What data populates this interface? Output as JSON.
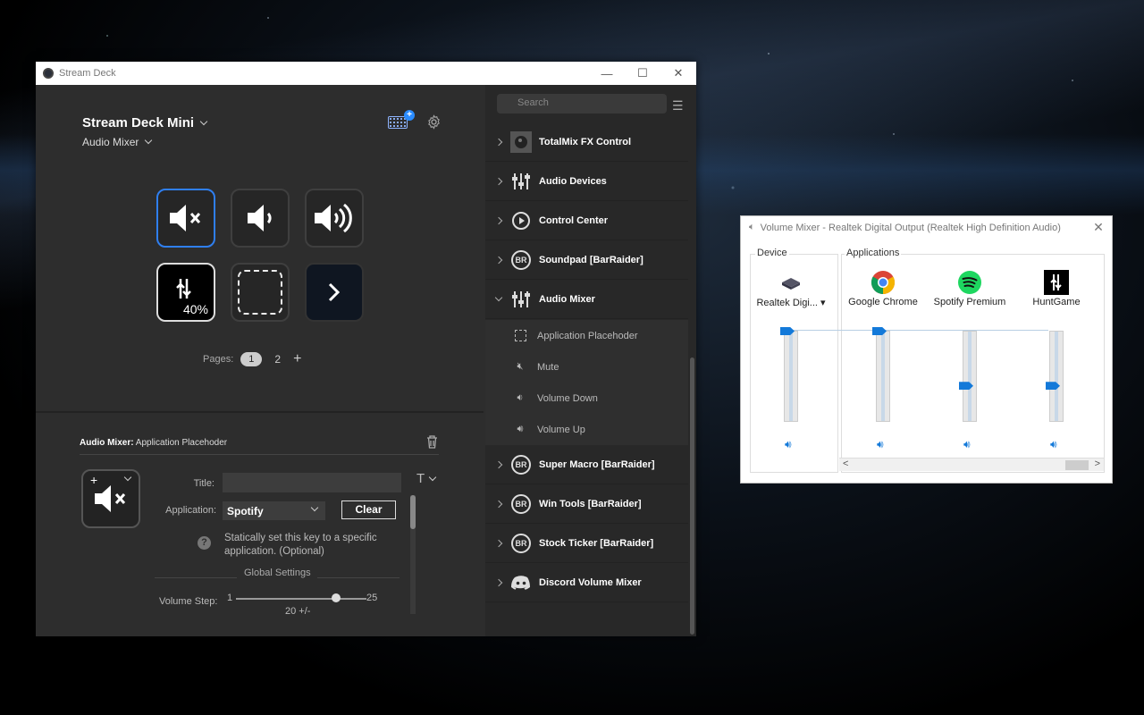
{
  "stream_deck": {
    "window_title": "Stream Deck",
    "device_name": "Stream Deck Mini",
    "profile_name": "Audio Mixer",
    "keys": [
      {
        "name": "mute-key",
        "label": ""
      },
      {
        "name": "volume-down-key",
        "label": ""
      },
      {
        "name": "volume-up-key",
        "label": ""
      },
      {
        "name": "huntgame-key",
        "label": "40%"
      },
      {
        "name": "placeholder-key",
        "label": ""
      },
      {
        "name": "next-page-key",
        "label": ""
      }
    ],
    "pages": {
      "label": "Pages:",
      "items": [
        "1",
        "2"
      ],
      "current": "1",
      "add": "+"
    },
    "properties": {
      "header_bold": "Audio Mixer:",
      "header_rest": " Application Placehoder",
      "title_label": "Title:",
      "title_value": "",
      "application_label": "Application:",
      "application_value": "Spotify",
      "clear_label": "Clear",
      "help_text": "Statically set this key to a specific application. (Optional)",
      "global_settings_label": "Global Settings",
      "volume_step_label": "Volume Step:",
      "slider_min": "1",
      "slider_max": "25",
      "slider_value": "20 +/-"
    },
    "search_placeholder": "Search",
    "categories_top": [
      {
        "label": "TotalMix FX Control",
        "icon": "totalmix-icon"
      },
      {
        "label": "Audio Devices",
        "icon": "sliders-icon"
      },
      {
        "label": "Control Center",
        "icon": "control-center-icon"
      },
      {
        "label": "Soundpad [BarRaider]",
        "icon": "barraider-icon"
      },
      {
        "label": "Audio Mixer",
        "icon": "sliders-icon",
        "expanded": true
      }
    ],
    "audio_mixer_actions": [
      {
        "label": "Application Placehoder",
        "icon": "placeholder-icon"
      },
      {
        "label": "Mute",
        "icon": "mute-icon"
      },
      {
        "label": "Volume Down",
        "icon": "volume-down-icon"
      },
      {
        "label": "Volume Up",
        "icon": "volume-up-icon"
      }
    ],
    "categories_bottom": [
      {
        "label": "Super Macro [BarRaider]",
        "icon": "barraider-icon"
      },
      {
        "label": "Win Tools [BarRaider]",
        "icon": "barraider-icon"
      },
      {
        "label": "Stock Ticker [BarRaider]",
        "icon": "barraider-icon"
      },
      {
        "label": "Discord Volume Mixer",
        "icon": "discord-icon"
      }
    ],
    "br_badge": "BR"
  },
  "volume_mixer": {
    "window_title": "Volume Mixer - Realtek Digital Output (Realtek High Definition Audio)",
    "device_group_label": "Device",
    "applications_group_label": "Applications",
    "channels": [
      {
        "name": "Realtek Digi...",
        "level": 1.0,
        "icon": "speaker-device-icon"
      },
      {
        "name": "Google Chrome",
        "level": 1.0,
        "icon": "chrome-icon"
      },
      {
        "name": "Spotify Premium",
        "level": 0.4,
        "icon": "spotify-icon"
      },
      {
        "name": "HuntGame",
        "level": 0.4,
        "icon": "huntgame-icon"
      }
    ],
    "scroll_left": "<",
    "scroll_right": ">"
  },
  "colors": {
    "accent_blue": "#2f7ff0",
    "mixer_blue": "#1379d9",
    "spotify_green": "#1ed760"
  }
}
